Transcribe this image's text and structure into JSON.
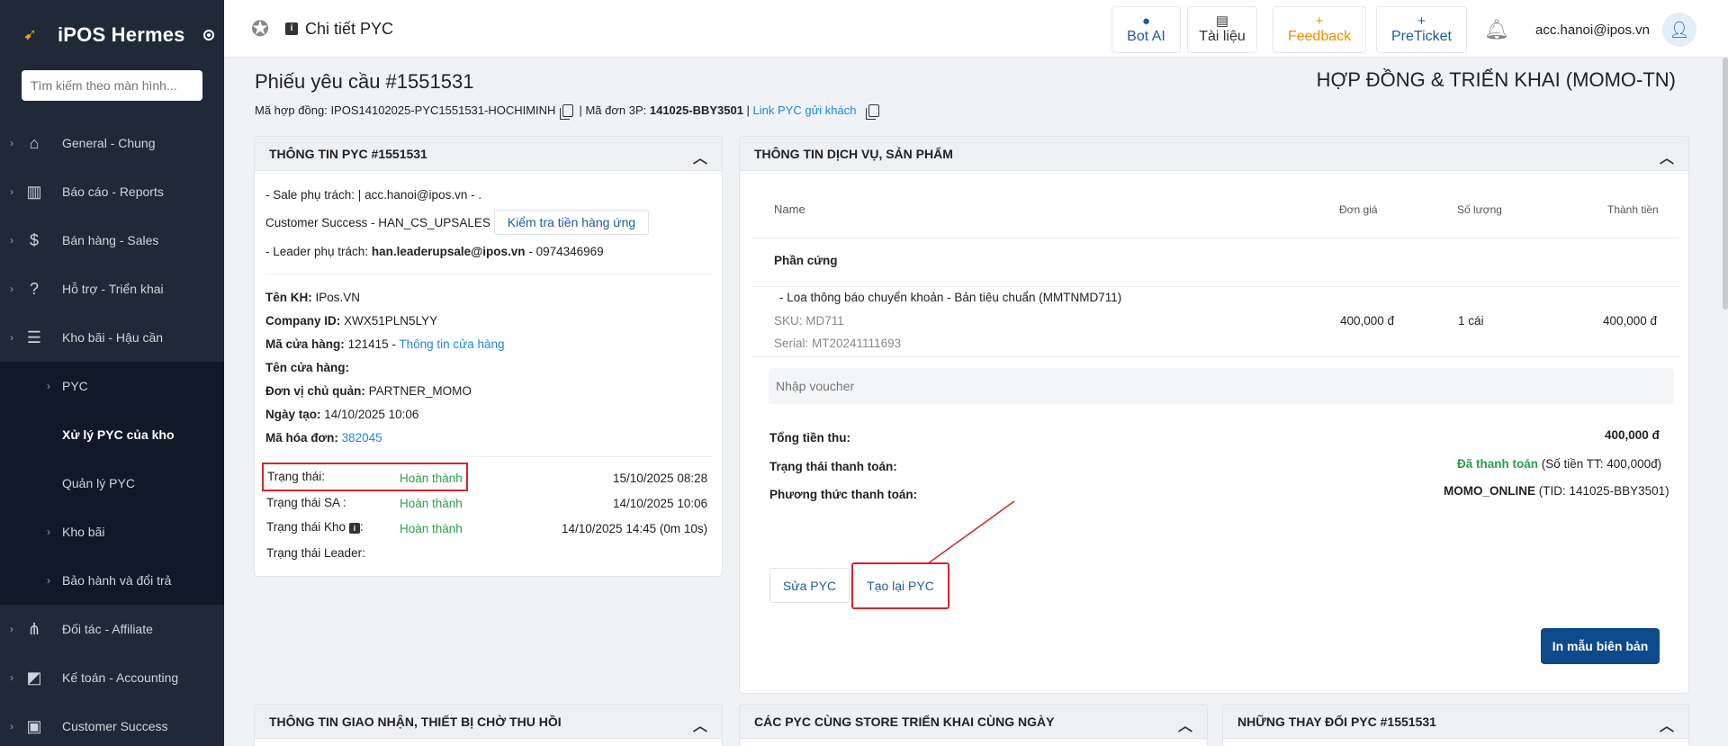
{
  "app": {
    "name": "iPOS Hermes"
  },
  "sidebar": {
    "search_placeholder": "Tìm kiếm theo màn hình...",
    "items": [
      {
        "label": "General - Chung",
        "icon": "home-icon"
      },
      {
        "label": "Báo cáo - Reports",
        "icon": "chart-icon"
      },
      {
        "label": "Bán hàng - Sales",
        "icon": "dollar-icon"
      },
      {
        "label": "Hỗ trợ - Triển khai",
        "icon": "help-icon"
      },
      {
        "label": "Kho bãi - Hậu cần",
        "icon": "list-icon"
      }
    ],
    "sub_items": [
      {
        "label": "PYC"
      },
      {
        "label": "Xử lý PYC của kho"
      },
      {
        "label": "Quản lý PYC"
      },
      {
        "label": "Kho bãi"
      },
      {
        "label": "Bảo hành và đổi trả"
      }
    ],
    "items_after": [
      {
        "label": "Đối tác - Affiliate",
        "icon": "network-icon"
      },
      {
        "label": "Kế toán - Accounting",
        "icon": "accounting-icon"
      },
      {
        "label": "Customer Success",
        "icon": "customer-icon"
      }
    ]
  },
  "topbar": {
    "title": "Chi tiết PYC",
    "bot_ai": "Bot AI",
    "docs": "Tài liệu",
    "feedback": "Feedback",
    "preticket": "PreTicket",
    "user_email": "acc.hanoi@ipos.vn"
  },
  "page": {
    "title": "Phiếu yêu cầu #1551531",
    "contract_type": "HỢP ĐỒNG & TRIỂN KHAI (MOMO-TN)",
    "contract_label": "Mã hợp đồng:",
    "contract_code": "IPOS14102025-PYC1551531-HOCHIMINH",
    "order_label": "| Mã đơn 3P:",
    "order_code": "141025-BBY3501",
    "link_label": "Link PYC gửi khách"
  },
  "pyc_info": {
    "header": "THÔNG TIN PYC #1551531",
    "sale": "- Sale phụ trách: | acc.hanoi@ipos.vn - .",
    "cs": "Customer Success - HAN_CS_UPSALES",
    "check_button": "Kiểm tra tiền hàng ứng",
    "leader_label": "- Leader phụ trách:",
    "leader_email": "han.leaderupsale@ipos.vn",
    "leader_phone": "- 0974346969",
    "customer_label": "Tên KH:",
    "customer": "IPos.VN",
    "company_label": "Company ID:",
    "company_id": "XWX51PLN5LYY",
    "store_code_label": "Mã cửa hàng:",
    "store_code": "121415 -",
    "store_info_link": "Thông tin cửa hàng",
    "store_name_label": "Tên cửa hàng:",
    "owner_label": "Đơn vị chủ quản:",
    "owner": "PARTNER_MOMO",
    "created_label": "Ngày tạo:",
    "created": "14/10/2025 10:06",
    "invoice_label": "Mã hóa đơn:",
    "invoice": "382045",
    "status_label": "Trạng thái:",
    "status": "Hoàn thành",
    "status_time": "15/10/2025 08:28",
    "sa_label": "Trạng thái SA :",
    "sa_status": "Hoàn thành",
    "sa_time": "14/10/2025 10:06",
    "kho_label": "Trạng thái Kho",
    "kho_status": "Hoàn thành",
    "kho_time": "14/10/2025 14:45 (0m 10s)",
    "leader_status_label": "Trạng thái Leader:"
  },
  "service_info": {
    "header": "THÔNG TIN DỊCH VỤ, SẢN PHẨM",
    "col_name": "Name",
    "col_price": "Đơn giá",
    "col_qty": "Số lượng",
    "col_total": "Thành tiền",
    "group": "Phần cứng",
    "item_name": "- Loa thông báo chuyển khoản - Bản tiêu chuẩn (MMTNMD711)",
    "item_sku": "SKU: MD711",
    "item_serial": "Serial: MT20241111693",
    "item_price": "400,000 đ",
    "item_qty": "1 cái",
    "item_total": "400,000 đ",
    "voucher_placeholder": "Nhập voucher",
    "total_label": "Tổng tiền thu:",
    "total": "400,000 đ",
    "pay_status_label": "Trạng thái thanh toán:",
    "pay_status": "Đã thanh toán",
    "pay_amount": "(Số tiền TT: 400,000đ)",
    "pay_method_label": "Phương thức thanh toán:",
    "pay_method": "MOMO_ONLINE",
    "pay_tid": "(TID: 141025-BBY3501)",
    "edit_button": "Sửa PYC",
    "recreate_button": "Tạo lại PYC",
    "print_button": "In mẫu biên bản"
  },
  "bottom_cards": {
    "delivery": "THÔNG TIN GIAO NHẬN, THIẾT BỊ CHỜ THU HỒI",
    "same_store": "CÁC PYC CÙNG STORE TRIỂN KHAI CÙNG NGÀY",
    "changes": "NHỮNG THAY ĐỔI PYC #1551531"
  }
}
